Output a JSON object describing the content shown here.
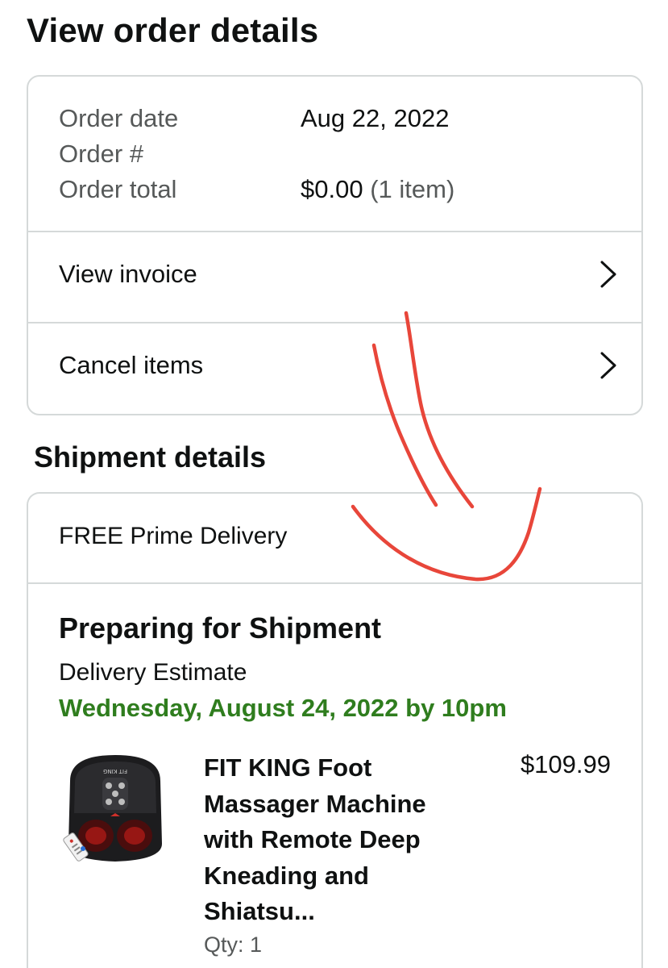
{
  "page": {
    "title": "View order details"
  },
  "order_summary": {
    "date_label": "Order date",
    "date_value": "Aug 22, 2022",
    "number_label": "Order #",
    "total_label": "Order total",
    "total_value": "$0.00",
    "total_items": "(1 item)"
  },
  "actions": {
    "view_invoice": "View invoice",
    "cancel_items": "Cancel items"
  },
  "shipment": {
    "section_title": "Shipment details",
    "delivery_type": "FREE Prime Delivery",
    "status": "Preparing for Shipment",
    "estimate_label": "Delivery Estimate",
    "estimate_date": "Wednesday, August 24, 2022 by 10pm",
    "estimate_color": "#2f7d1e"
  },
  "product": {
    "title_lines": [
      "FIT KING Foot",
      "Massager Machine",
      "with Remote Deep",
      "Kneading and",
      "Shiatsu..."
    ],
    "price": "$109.99",
    "qty": "Qty: 1",
    "image_icon": "foot-massager-image",
    "brand_mark": "FIT KING"
  },
  "annotation": {
    "color": "#e8463a",
    "icon": "hand-drawn-arrow"
  }
}
